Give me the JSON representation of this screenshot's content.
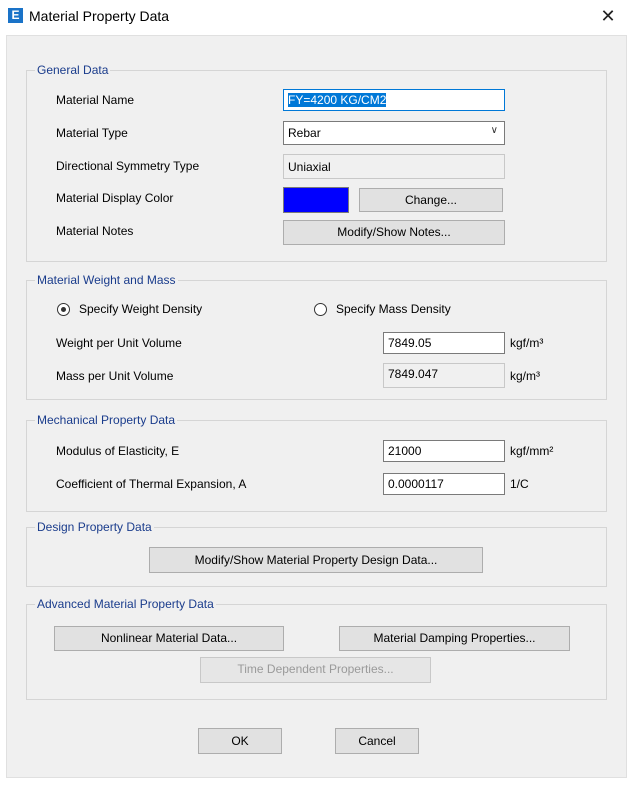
{
  "window": {
    "title": "Material Property Data",
    "icon_letter": "E",
    "close_glyph": "✕"
  },
  "general": {
    "legend": "General Data",
    "material_name_label": "Material Name",
    "material_name_value": "FY=4200  KG/CM2",
    "material_type_label": "Material Type",
    "material_type_value": "Rebar",
    "directional_symmetry_label": "Directional Symmetry Type",
    "directional_symmetry_value": "Uniaxial",
    "display_color_label": "Material Display Color",
    "display_color": "#0000ff",
    "change_button": "Change...",
    "notes_label": "Material Notes",
    "notes_button": "Modify/Show Notes..."
  },
  "weight_mass": {
    "legend": "Material Weight and Mass",
    "radio_weight_label": "Specify Weight Density",
    "radio_mass_label": "Specify Mass Density",
    "selected": "weight",
    "weight_label": "Weight per Unit Volume",
    "weight_value": "7849.05",
    "weight_unit": "kgf/m³",
    "mass_label": "Mass per Unit Volume",
    "mass_value": "7849.047",
    "mass_unit": "kg/m³"
  },
  "mechanical": {
    "legend": "Mechanical Property Data",
    "modulus_label": "Modulus of Elasticity,  E",
    "modulus_value": "21000",
    "modulus_unit": "kgf/mm²",
    "thermal_label": "Coefficient of Thermal Expansion,  A",
    "thermal_value": "0.0000117",
    "thermal_unit": "1/C"
  },
  "design": {
    "legend": "Design Property Data",
    "button": "Modify/Show Material Property Design Data..."
  },
  "advanced": {
    "legend": "Advanced Material Property Data",
    "nonlinear_button": "Nonlinear Material Data...",
    "damping_button": "Material Damping Properties...",
    "time_dependent_button": "Time Dependent Properties..."
  },
  "footer": {
    "ok_button": "OK",
    "cancel_button": "Cancel"
  }
}
